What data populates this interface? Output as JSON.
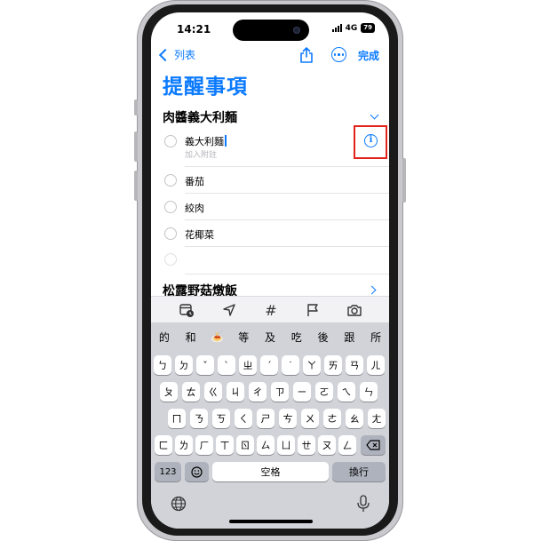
{
  "status": {
    "time": "14:21",
    "network": "4G",
    "battery": "79"
  },
  "nav": {
    "back_label": "列表",
    "done_label": "完成"
  },
  "list_title": "提醒事項",
  "sections": [
    {
      "title": "肉醬義大利麵",
      "items": [
        {
          "text": "義大利麵",
          "note": "加入附註"
        },
        {
          "text": "番茄"
        },
        {
          "text": "絞肉"
        },
        {
          "text": "花椰菜"
        },
        {
          "text": ""
        }
      ]
    },
    {
      "title": "松露野菇燉飯"
    }
  ],
  "toolbar": {
    "icons": [
      "calendar-clock-icon",
      "location-arrow-icon",
      "hashtag-icon",
      "flag-icon",
      "camera-icon"
    ],
    "hash_glyph": "#"
  },
  "keyboard": {
    "candidates": [
      "的",
      "和",
      "🍝",
      "等",
      "及",
      "吃",
      "後",
      "跟",
      "所"
    ],
    "row1": [
      "ㄅ",
      "ㄉ",
      "ˇ",
      "ˋ",
      "ㄓ",
      "ˊ",
      "˙",
      "ㄚ",
      "ㄞ",
      "ㄢ",
      "ㄦ"
    ],
    "row2": [
      "ㄆ",
      "ㄊ",
      "ㄍ",
      "ㄐ",
      "ㄔ",
      "ㄗ",
      "ㄧ",
      "ㄛ",
      "ㄟ",
      "ㄣ"
    ],
    "row3": [
      "ㄇ",
      "ㄋ",
      "ㄎ",
      "ㄑ",
      "ㄕ",
      "ㄘ",
      "ㄨ",
      "ㄜ",
      "ㄠ",
      "ㄤ"
    ],
    "row4": [
      "ㄈ",
      "ㄌ",
      "ㄏ",
      "ㄒ",
      "ㄖ",
      "ㄙ",
      "ㄩ",
      "ㄝ",
      "ㄡ",
      "ㄥ"
    ],
    "numbers_label": "123",
    "space_label": "空格",
    "return_label": "換行"
  },
  "colors": {
    "accent": "#0a7aff",
    "highlight": "#e2231a"
  }
}
